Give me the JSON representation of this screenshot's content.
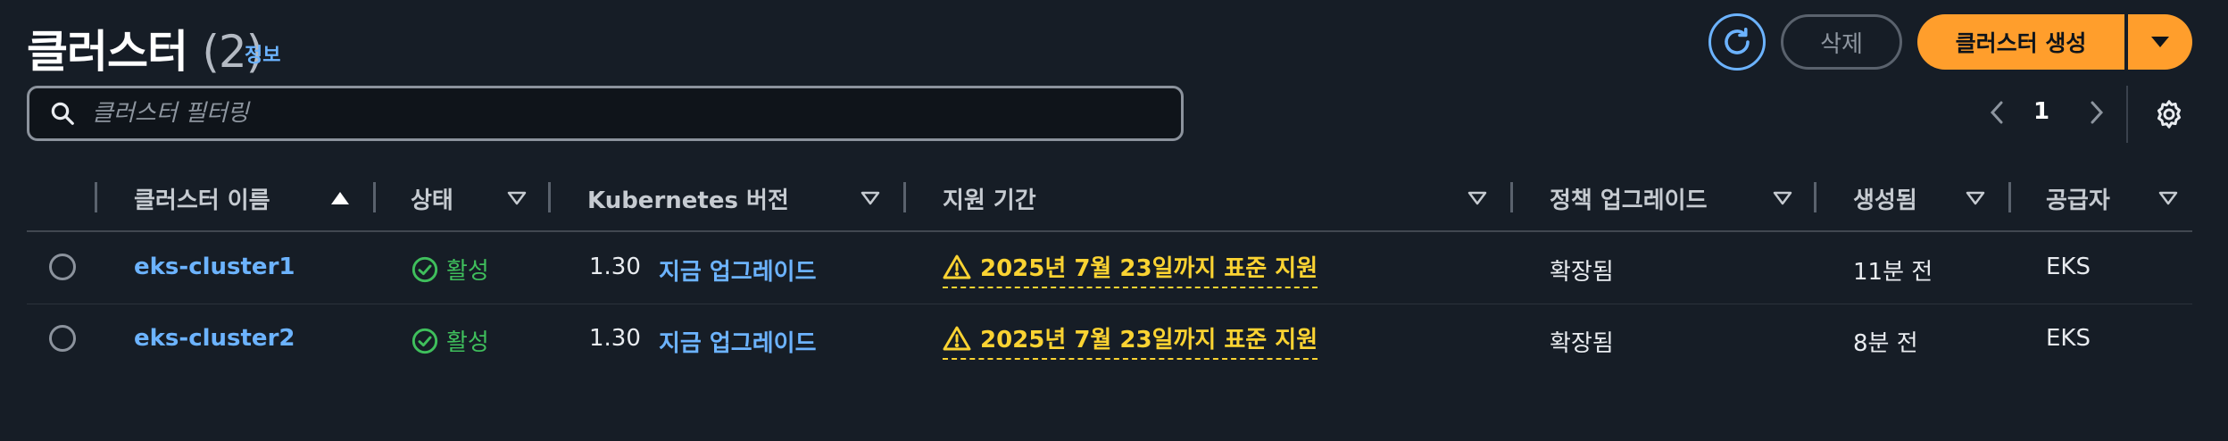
{
  "header": {
    "title": "클러스터",
    "count": "(2)",
    "info_link": "정보",
    "delete_label": "삭제",
    "create_label": "클러스터 생성"
  },
  "filter": {
    "placeholder": "클러스터 필터링"
  },
  "pagination": {
    "current_page": "1"
  },
  "columns": {
    "name": "클러스터 이름",
    "status": "상태",
    "k8s_version": "Kubernetes 버전",
    "support_period": "지원 기간",
    "upgrade_policy": "정책 업그레이드",
    "created": "생성됨",
    "provider": "공급자"
  },
  "rows": [
    {
      "name": "eks-cluster1",
      "status": "활성",
      "version": "1.30",
      "upgrade_link": "지금 업그레이드",
      "support": "2025년 7월 23일까지 표준 지원",
      "policy": "확장됨",
      "created": "11분 전",
      "provider": "EKS"
    },
    {
      "name": "eks-cluster2",
      "status": "활성",
      "version": "1.30",
      "upgrade_link": "지금 업그레이드",
      "support": "2025년 7월 23일까지 표준 지원",
      "policy": "확장됨",
      "created": "8분 전",
      "provider": "EKS"
    }
  ],
  "colors": {
    "background": "#161d26",
    "link": "#6cb3ff",
    "primary": "#ff9e2c",
    "success": "#3fbf5c",
    "warning": "#fbd332"
  },
  "icons": {
    "refresh": "refresh-icon",
    "dropdown": "caret-down-icon",
    "search": "search-icon",
    "prev": "chevron-left-icon",
    "next": "chevron-right-icon",
    "settings": "gear-icon",
    "sort_asc": "sort-ascending-icon",
    "sort": "sort-caret-icon",
    "status": "check-circle-icon",
    "warning": "warning-icon"
  }
}
